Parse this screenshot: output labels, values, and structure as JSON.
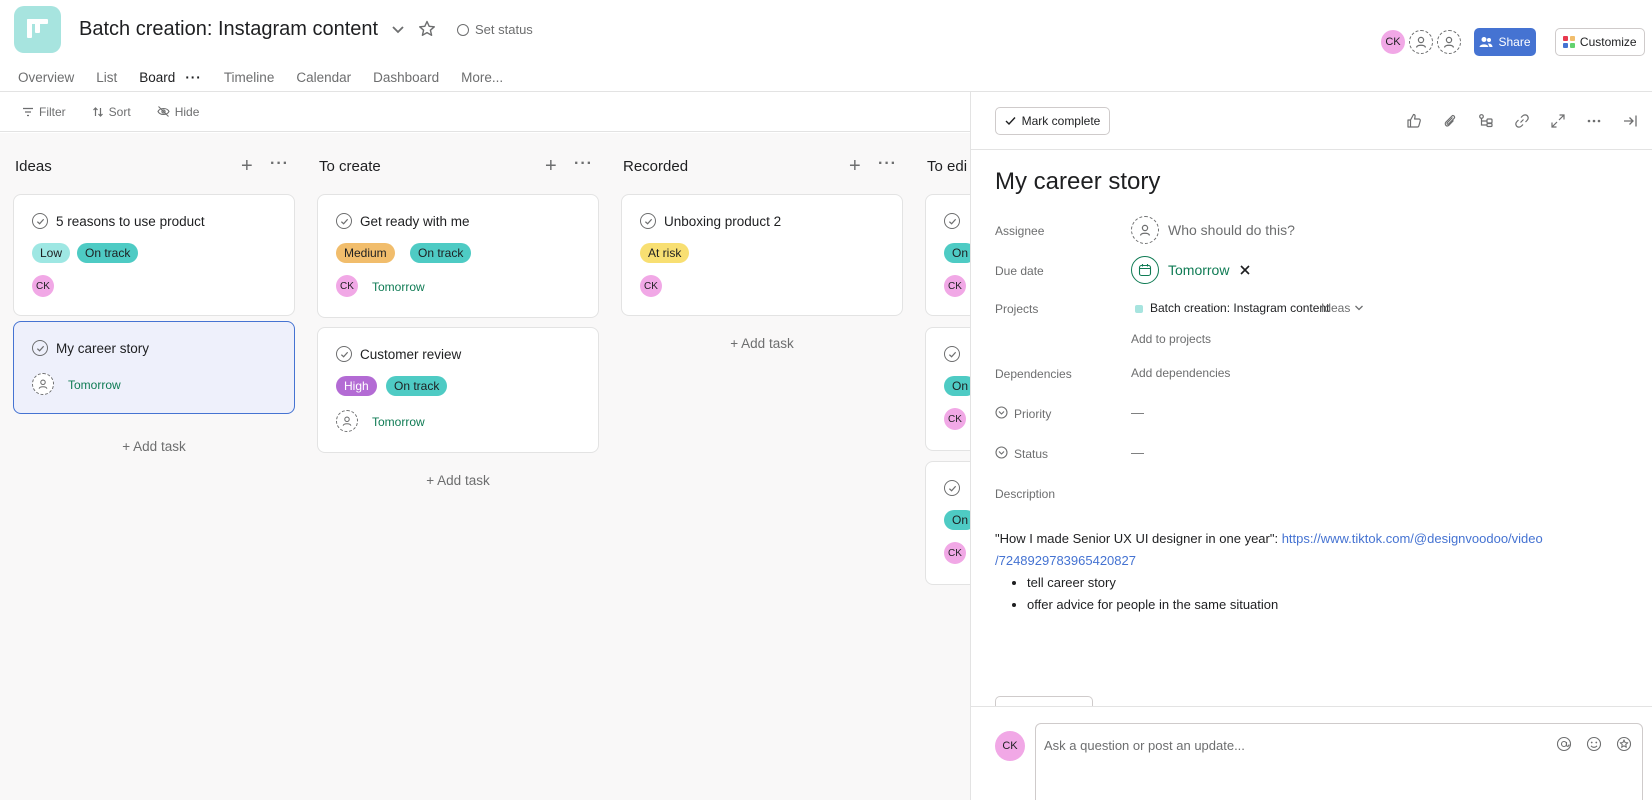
{
  "header": {
    "project_title": "Batch creation: Instagram content",
    "set_status": "Set status",
    "tabs": [
      "Overview",
      "List",
      "Board",
      "Timeline",
      "Calendar",
      "Dashboard",
      "More..."
    ],
    "avatar_initials": "CK",
    "share_label": "Share",
    "customize_label": "Customize"
  },
  "toolbar": {
    "filter": "Filter",
    "sort": "Sort",
    "hide": "Hide"
  },
  "columns": [
    {
      "title": "Ideas",
      "cards": [
        {
          "title": "5 reasons to use product",
          "tags": [
            "Low",
            "On track"
          ],
          "avatar": "CK"
        },
        {
          "title": "My career story",
          "due": "Tomorrow"
        }
      ],
      "add_task": "Add task"
    },
    {
      "title": "To create",
      "cards": [
        {
          "title": "Get ready with me",
          "tags": [
            "Medium",
            "On track"
          ],
          "avatar": "CK",
          "due": "Tomorrow"
        },
        {
          "title": "Customer review",
          "tags": [
            "High",
            "On track"
          ],
          "due": "Tomorrow"
        }
      ],
      "add_task": "Add task"
    },
    {
      "title": "Recorded",
      "cards": [
        {
          "title": "Unboxing product 2",
          "tags": [
            "At risk"
          ],
          "avatar": "CK"
        }
      ],
      "add_task": "Add task"
    },
    {
      "title": "To edi",
      "peek_tags": [
        "On",
        "On",
        "On"
      ],
      "peek_initials": [
        "CK",
        "CK",
        "CK"
      ]
    }
  ],
  "colors": {
    "low": "#9ee7e3",
    "on_track": "#4ecbc4",
    "medium": "#f1bd6c",
    "high": "#b36bd4",
    "at_risk": "#f8df72",
    "accent": "#4573d2",
    "due": "#0f7b54"
  },
  "pane": {
    "mark_complete": "Mark complete",
    "task_title": "My career story",
    "labels": {
      "assignee": "Assignee",
      "due_date": "Due date",
      "projects": "Projects",
      "dependencies": "Dependencies",
      "priority": "Priority",
      "status": "Status",
      "description": "Description"
    },
    "assignee_placeholder": "Who should do this?",
    "due_value": "Tomorrow",
    "project_name": "Batch creation: Instagram content",
    "project_section": "Ideas",
    "add_to_projects": "Add to projects",
    "add_dependencies": "Add dependencies",
    "priority_value": "—",
    "status_value": "—",
    "description": {
      "quote": "\"How I made Senior UX UI designer in one year\": ",
      "link_line1": "https://www.tiktok.com/@designvoodoo/video",
      "link_line2": "/7248929783965420827",
      "bullets": [
        "tell career story",
        "offer advice for people in the same situation"
      ]
    },
    "comment_avatar": "CK",
    "comment_placeholder": "Ask a question or post an update..."
  }
}
